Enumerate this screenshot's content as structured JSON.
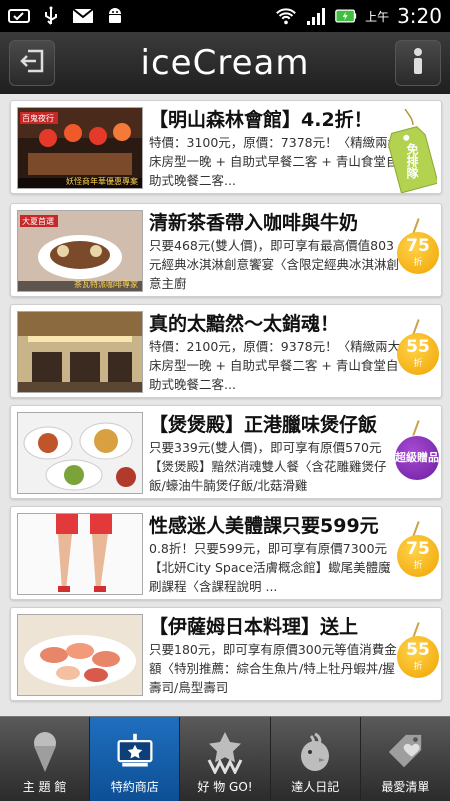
{
  "status_bar": {
    "time": "3:20",
    "ampm": "上午",
    "icons": [
      "hdd-check-icon",
      "usb-icon",
      "gmail-icon",
      "android-icon",
      "wifi-icon",
      "signal-icon",
      "battery-charging-icon"
    ]
  },
  "header": {
    "title": "iceCream",
    "back_icon": "logout-icon",
    "info_icon": "info-icon"
  },
  "deals": [
    {
      "title": "【明山森林會館】4.2折！",
      "description": "特價：3100元，原價：7378元！〈精緻兩大床房型一晚 + 自助式早餐二客 + 青山食堂自助式晚餐二客...",
      "thumb_caption": "妖怪商年華優惠專案",
      "thumb_tag": "百鬼夜行",
      "badge": {
        "type": "tag",
        "text": "免排隊"
      }
    },
    {
      "title": "清新茶香帶入咖啡與牛奶",
      "description": "只要468元(雙人價)，即可享有最高價值803元經典冰淇淋創意饗宴〈含限定經典冰淇淋創意主廚",
      "thumb_caption": "茶瓦特派咖啡專家",
      "thumb_tag": "大夏首選",
      "badge": {
        "type": "discount",
        "number": "75",
        "unit": "折"
      }
    },
    {
      "title": "真的太黯然～太銷魂！",
      "description": "特價：2100元，原價：9378元！〈精緻兩大床房型一晚 + 自助式早餐二客 + 青山食堂自助式晚餐二客...",
      "thumb_caption": "",
      "thumb_tag": "",
      "badge": {
        "type": "discount",
        "number": "55",
        "unit": "折"
      }
    },
    {
      "title": "【煲煲殿】正港臘味煲仔飯",
      "description": "只要339元(雙人價)，即可享有原價570元【煲煲殿】黯然消魂雙人餐〈含花雕雞煲仔飯/蠔油牛腩煲仔飯/北菇滑雞",
      "thumb_caption": "",
      "thumb_tag": "",
      "badge": {
        "type": "special",
        "text": "超級贈品"
      }
    },
    {
      "title": "性感迷人美體課只要599元",
      "description": "0.8折！只要599元，即可享有原價7300元【北妍City Space活膚概念館】蠍尾美體魔刷課程〈含課程說明 ...",
      "thumb_caption": "",
      "thumb_tag": "",
      "badge": {
        "type": "discount",
        "number": "75",
        "unit": "折"
      }
    },
    {
      "title": "【伊薩姆日本料理】送上",
      "description": "只要180元，即可享有原價300元等值消費金額〈特別推薦：綜合生魚片/特上牡丹蝦丼/握壽司/鳥型壽司",
      "thumb_caption": "",
      "thumb_tag": "",
      "badge": {
        "type": "discount",
        "number": "55",
        "unit": "折"
      }
    }
  ],
  "tabs": [
    {
      "label": "主 題 館",
      "icon": "ice-cream-icon",
      "active": false
    },
    {
      "label": "特約商店",
      "icon": "store-sign-icon",
      "active": true
    },
    {
      "label": "好 物 GO!",
      "icon": "star-w-icon",
      "active": false
    },
    {
      "label": "達人日記",
      "icon": "chick-icon",
      "active": false
    },
    {
      "label": "最愛清單",
      "icon": "heart-tag-icon",
      "active": false
    }
  ],
  "colors": {
    "header_bg": "#2a2a2a",
    "active_tab": "#1565b0",
    "badge_orange": "#f4b400",
    "badge_purple": "#7a2aa8",
    "tag_green": "#a9c948"
  }
}
